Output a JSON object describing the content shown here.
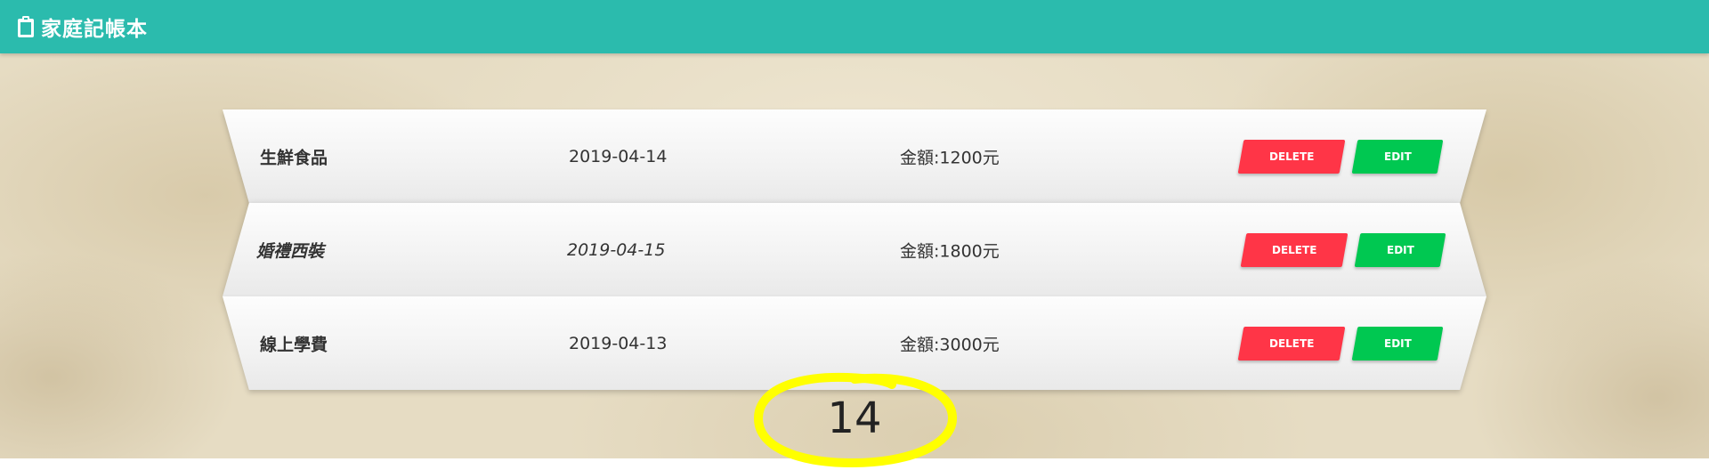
{
  "navbar": {
    "icon": "clipboard-icon",
    "title": "家庭記帳本",
    "color": "#2bbbad"
  },
  "records": [
    {
      "item": "生鮮食品",
      "date": "2019-04-14",
      "amount": "金額:1200元",
      "delete_label": "DELETE",
      "edit_label": "EDIT"
    },
    {
      "item": "婚禮西裝",
      "date": "2019-04-15",
      "amount": "金額:1800元",
      "delete_label": "DELETE",
      "edit_label": "EDIT"
    },
    {
      "item": "線上學費",
      "date": "2019-04-13",
      "amount": "金額:3000元",
      "delete_label": "DELETE",
      "edit_label": "EDIT"
    }
  ],
  "total": "14",
  "colors": {
    "delete": "#ff3547",
    "edit": "#00c851",
    "highlight": "#ffff00"
  }
}
